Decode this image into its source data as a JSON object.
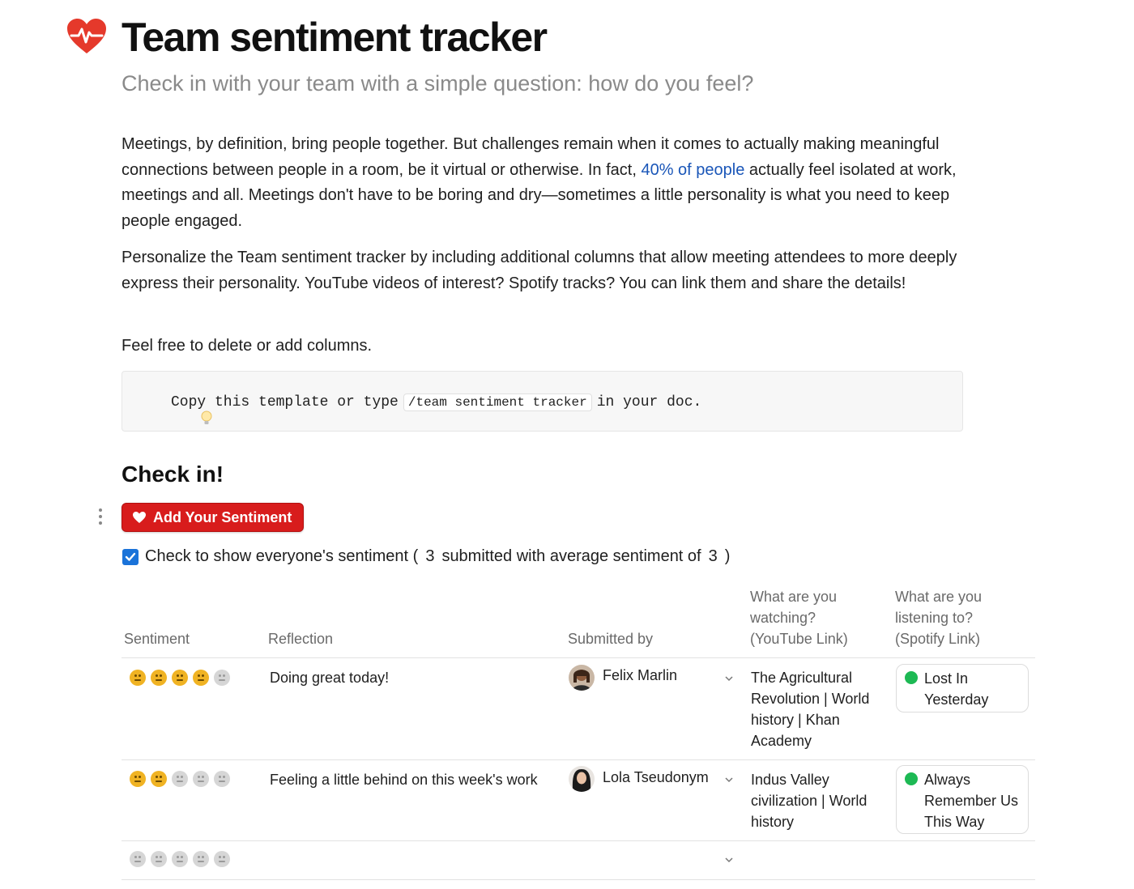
{
  "page": {
    "icon": "heartbeat-icon",
    "title": "Team sentiment tracker",
    "subtitle": "Check in with your team with a simple question: how do you feel?"
  },
  "intro": {
    "p1_before": "Meetings, by definition, bring people together. But challenges remain when it comes to actually making meaningful connections between people in a room, be it virtual or otherwise. In fact, ",
    "p1_link": "40% of people",
    "p1_after": " actually feel isolated at work, meetings and all. Meetings don't have to be boring and dry—sometimes a little personality is what you need to keep people engaged.",
    "p2": "Personalize the Team sentiment tracker by including additional columns that allow meeting attendees to more deeply express their personality. YouTube videos of interest? Spotify tracks? You can link them and share the details!",
    "p3": "Feel free to delete or add columns."
  },
  "callout": {
    "icon": "lightbulb-icon",
    "before": "Copy this template or type",
    "code": "/team sentiment tracker",
    "after": "in your doc."
  },
  "section": {
    "heading": "Check in!",
    "button_label": "Add Your Sentiment",
    "checkbox_checked": true,
    "check_text_before": "Check to show everyone's sentiment (",
    "submitted_count": "3",
    "check_text_middle": "submitted with average sentiment of",
    "average_sentiment": "3",
    "check_text_after": ")"
  },
  "table": {
    "headers": {
      "sentiment": "Sentiment",
      "reflection": "Reflection",
      "submitted_by": "Submitted by",
      "watching": "What are you watching? (YouTube Link)",
      "listening": "What are you listening to? (Spotify Link)"
    },
    "rows": [
      {
        "sentiment": 4,
        "max": 5,
        "reflection": "Doing great today!",
        "person": "Felix Marlin",
        "watching": "The Agricultural Revolution | World history | Khan Academy",
        "listening": "Lost In Yesterday"
      },
      {
        "sentiment": 2,
        "max": 5,
        "reflection": "Feeling a little behind on this week's work",
        "person": "Lola Tseudonym",
        "watching": "Indus Valley civilization | World history",
        "listening": "Always Remember Us This Way"
      },
      {
        "sentiment": 0,
        "max": 5,
        "reflection": "",
        "person": "",
        "watching": "",
        "listening": ""
      }
    ]
  },
  "colors": {
    "accent_red": "#d81c1c",
    "link_blue": "#1a56b8",
    "checkbox_blue": "#1a73d9",
    "sentiment_on": "#f0b323",
    "sentiment_off": "#d6d6d6",
    "spotify_green": "#1db954"
  }
}
